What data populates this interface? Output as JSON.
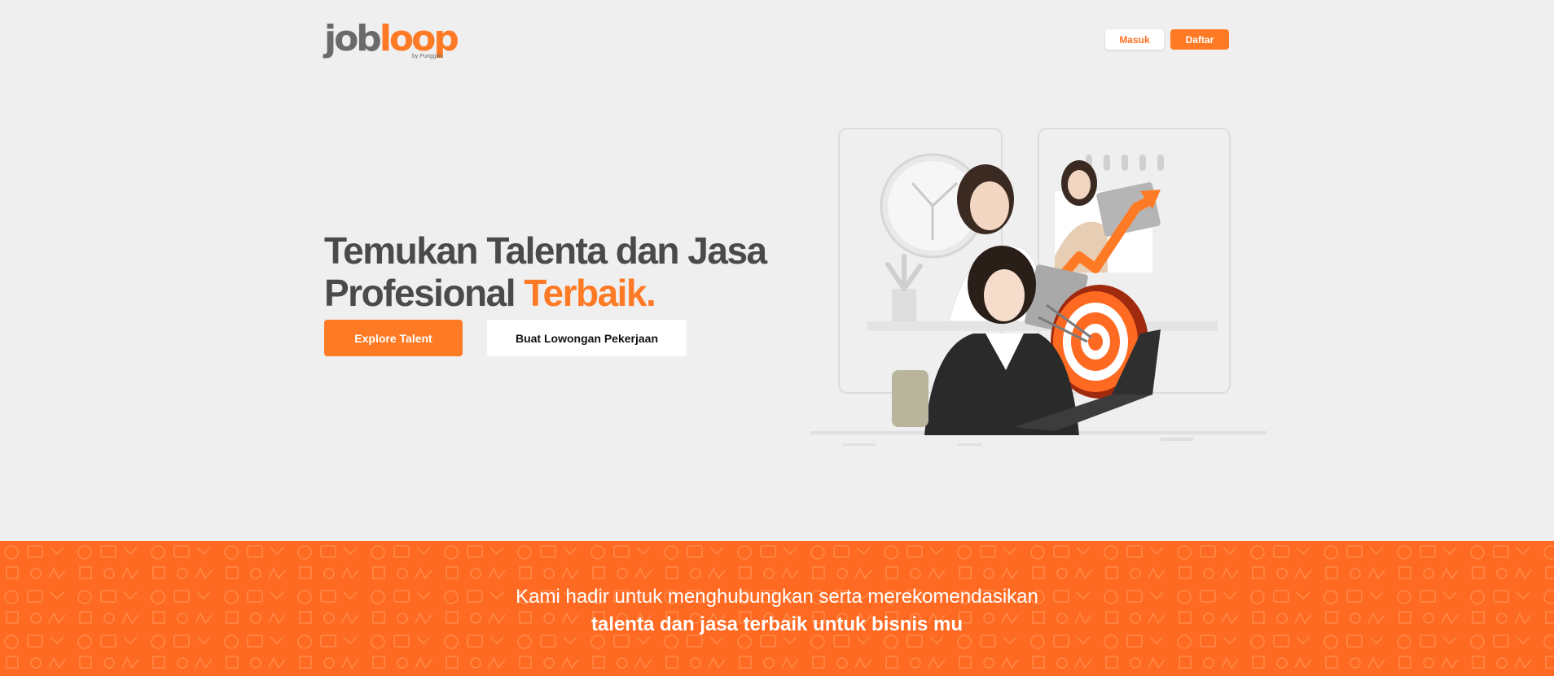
{
  "header": {
    "logo": {
      "part_grey": "job",
      "part_orange": "loop",
      "byline": "by Punggilin"
    },
    "login_label": "Masuk",
    "register_label": "Daftar"
  },
  "hero": {
    "headline_main": "Temukan Talenta dan Jasa Profesional ",
    "headline_accent": "Terbaik.",
    "explore_label": "Explore Talent",
    "post_job_label": "Buat Lowongan Pekerjaan",
    "illustration": "professionals-with-target-and-growth-arrow"
  },
  "banner": {
    "line1": "Kami hadir untuk menghubungkan serta merekomendasikan",
    "line2": "talenta dan jasa terbaik untuk bisnis mu"
  },
  "colors": {
    "accent": "#ff7a24",
    "banner": "#ff6a22",
    "hero_bg": "#efefef",
    "headline": "#4a4a4a"
  }
}
